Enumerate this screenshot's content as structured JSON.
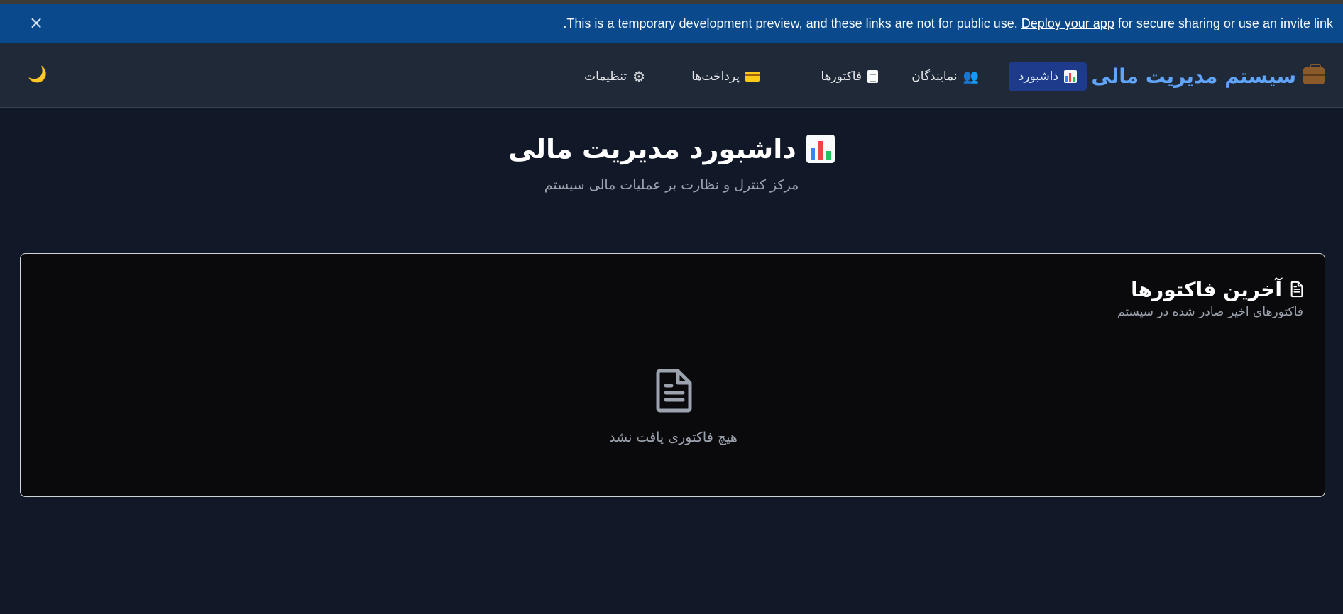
{
  "banner": {
    "text_before": ".This is a temporary development preview, and these links are not for public use. ",
    "link_text": "Deploy your app",
    "text_after": " for secure sharing or use an invite link",
    "close_label": "×"
  },
  "navbar": {
    "brand": "سیستم مدیریت مالی",
    "brand_icon": "briefcase-icon",
    "items": [
      {
        "label": "داشبورد",
        "icon": "bar-chart-icon",
        "active": true
      },
      {
        "label": "نمایندگان",
        "icon": "people-icon",
        "active": false
      },
      {
        "label": "فاکتورها",
        "icon": "document-icon",
        "active": false
      },
      {
        "label": "پرداخت‌ها",
        "icon": "credit-card-icon",
        "active": false
      },
      {
        "label": "تنظیمات",
        "icon": "gear-icon",
        "active": false
      }
    ],
    "theme_toggle": "🌙"
  },
  "main": {
    "title": "داشبورد مدیریت مالی",
    "subtitle": "مرکز کنترل و نظارت بر عملیات مالی سیستم"
  },
  "card": {
    "title": "آخرین فاکتورها",
    "description": "فاکتورهای اخیر صادر شده در سیستم",
    "empty_text": "هیچ فاکتوری یافت نشد"
  },
  "colors": {
    "background": "#111827",
    "banner": "#0a4a8c",
    "navbar": "#1f2937",
    "brand": "#60a5fa",
    "active_nav": "#1e3a8a",
    "card_bg": "#0a0a0c"
  }
}
